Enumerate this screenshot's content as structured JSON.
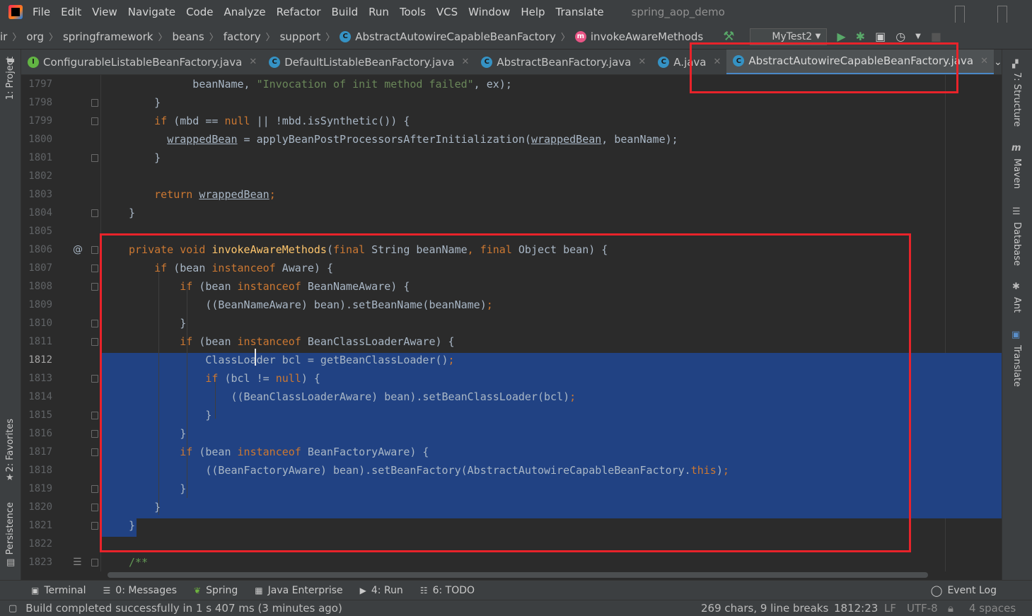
{
  "app": {
    "window_title": "spring_aop_demo",
    "menu": [
      "File",
      "Edit",
      "View",
      "Navigate",
      "Code",
      "Analyze",
      "Refactor",
      "Build",
      "Run",
      "Tools",
      "VCS",
      "Window",
      "Help",
      "Translate"
    ]
  },
  "breadcrumb": {
    "items": [
      "ir",
      "org",
      "springframework",
      "beans",
      "factory",
      "support",
      "AbstractAutowireCapableBeanFactory",
      "invokeAwareMethods"
    ],
    "run_config": "MyTest2"
  },
  "tabs": [
    {
      "label": "ConfigurableListableBeanFactory.java",
      "icon": "interface-icon"
    },
    {
      "label": "DefaultListableBeanFactory.java",
      "icon": "class-icon"
    },
    {
      "label": "AbstractBeanFactory.java",
      "icon": "abstract-class-icon"
    },
    {
      "label": "A.java",
      "icon": "class-icon"
    },
    {
      "label": "AbstractAutowireCapableBeanFactory.java",
      "icon": "abstract-class-icon",
      "active": true
    }
  ],
  "left_tool_windows": {
    "project": "1: Project",
    "favorites": "2: Favorites",
    "persistence": "Persistence"
  },
  "right_tool_windows": {
    "structure": "7: Structure",
    "maven": "Maven",
    "database": "Database",
    "ant": "Ant",
    "translate": "Translate"
  },
  "editor": {
    "line_numbers": [
      "1797",
      "1798",
      "1799",
      "1800",
      "1801",
      "1802",
      "1803",
      "1804",
      "1805",
      "1806",
      "1807",
      "1808",
      "1809",
      "1810",
      "1811",
      "1812",
      "1813",
      "1814",
      "1815",
      "1816",
      "1817",
      "1818",
      "1819",
      "1820",
      "1821",
      "1822",
      "1823"
    ],
    "current_line": "1812",
    "gutter_annotation": "@"
  },
  "tool_windows_bottom": [
    {
      "label": "Terminal",
      "icon": "terminal-icon"
    },
    {
      "label": "0: Messages",
      "icon": "messages-icon"
    },
    {
      "label": "Spring",
      "icon": "spring-icon"
    },
    {
      "label": "Java Enterprise",
      "icon": "java-enterprise-icon"
    },
    {
      "label": "4: Run",
      "icon": "run-icon"
    },
    {
      "label": "6: TODO",
      "icon": "todo-icon"
    }
  ],
  "event_log": "Event Log",
  "status": {
    "message": "Build completed successfully in 1 s 407 ms (3 minutes ago)",
    "selection_info": "269 chars, 9 line breaks",
    "position": "1812:23",
    "line_sep": "LF",
    "encoding": "UTF-8",
    "indent": "4 spaces"
  },
  "colors": {
    "keyword": "#cc7832",
    "string": "#6a8759",
    "method": "#ffc66d",
    "selection": "#214283",
    "highlight_box": "#e8232a"
  }
}
